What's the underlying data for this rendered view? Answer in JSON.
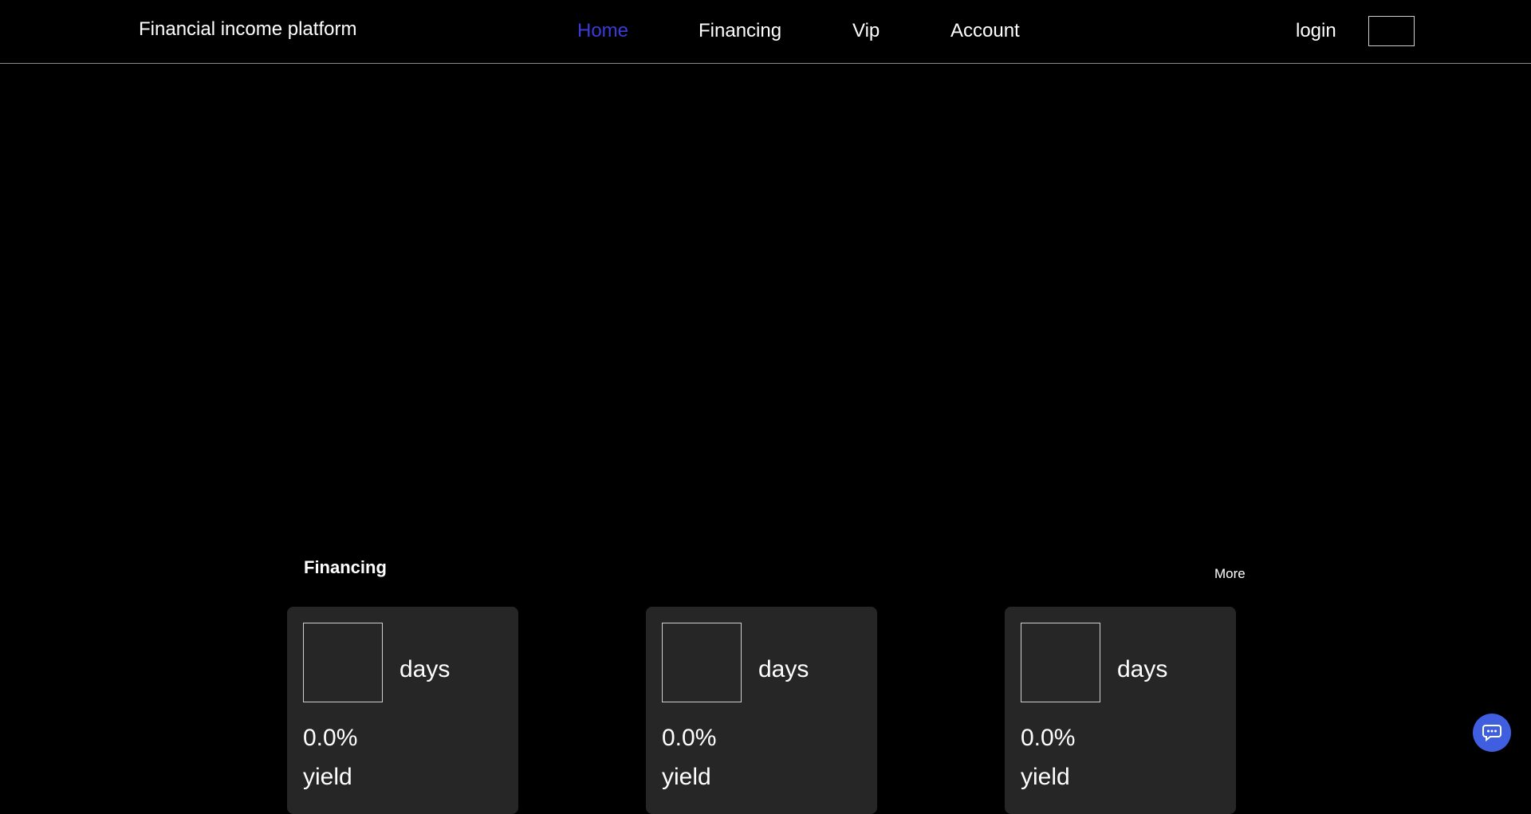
{
  "header": {
    "brand": "Financial income platform",
    "nav": [
      {
        "label": "Home",
        "active": true
      },
      {
        "label": "Financing",
        "active": false
      },
      {
        "label": "Vip",
        "active": false
      },
      {
        "label": "Account",
        "active": false
      }
    ],
    "login_label": "login"
  },
  "colors": {
    "background": "#000000",
    "card_background": "#262626",
    "nav_active": "#3b3bd8",
    "chat_button": "#3f5fe0"
  },
  "financing": {
    "title": "Financing",
    "more_label": "More",
    "products": [
      {
        "days_label": "days",
        "rate": "0.0%",
        "yield_label": "yield"
      },
      {
        "days_label": "days",
        "rate": "0.0%",
        "yield_label": "yield"
      },
      {
        "days_label": "days",
        "rate": "0.0%",
        "yield_label": "yield"
      }
    ]
  },
  "chat": {
    "icon": "chat-bubble-icon"
  }
}
